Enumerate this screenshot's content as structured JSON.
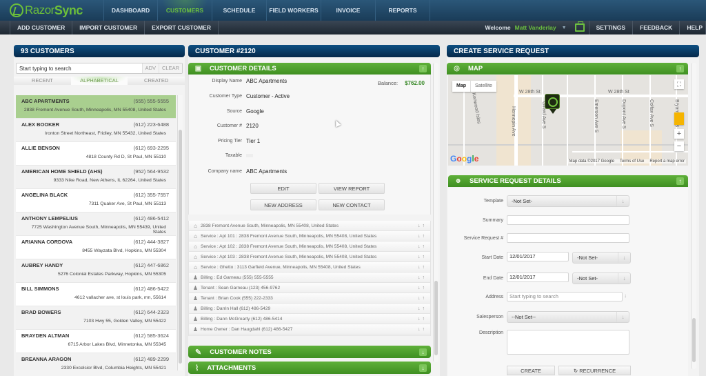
{
  "brand": {
    "name_part1": "Razor",
    "name_part2": "Sync",
    "accent": "#6cc040"
  },
  "nav": {
    "items": [
      {
        "label": "DASHBOARD",
        "active": false
      },
      {
        "label": "CUSTOMERS",
        "active": true
      },
      {
        "label": "SCHEDULE",
        "active": false
      },
      {
        "label": "FIELD WORKERS",
        "active": false
      },
      {
        "label": "INVOICE",
        "active": false
      },
      {
        "label": "REPORTS",
        "active": false
      }
    ]
  },
  "subnav": {
    "left": [
      "ADD CUSTOMER",
      "IMPORT CUSTOMER",
      "EXPORT CUSTOMER"
    ],
    "welcome": "Welcome",
    "user": "Matt Vanderlay",
    "caret": "▼",
    "right": [
      "SETTINGS",
      "FEEDBACK",
      "HELP"
    ]
  },
  "customers_panel": {
    "title": "93 CUSTOMERS",
    "search_placeholder": "Start typing to search",
    "adv_label": "ADV",
    "clear_label": "CLEAR",
    "tabs": [
      {
        "label": "RECENT",
        "active": false
      },
      {
        "label": "ALPHABETICAL",
        "active": true
      },
      {
        "label": "CREATED",
        "active": false
      }
    ],
    "customers": [
      {
        "name": "ABC APARTMENTS",
        "phone": "(555) 555-5555",
        "address": "2838 Fremont Avenue South, Minneapolis, MN 55408, United States",
        "selected": true
      },
      {
        "name": "ALEX BOOKER",
        "phone": "(612) 223-6488",
        "address": "Ironton Street Northeast, Fridley, MN 55432, United States"
      },
      {
        "name": "ALLIE BENSON",
        "phone": "(612) 693-2295",
        "address": "4818 County Rd D, St Paul, MN 55110"
      },
      {
        "name": "AMERICAN HOME SHIELD (AHS)",
        "phone": "(952) 564-9532",
        "address": "9333 Nike Road, New Athens, IL 62264, United States"
      },
      {
        "name": "ANGELINA BLACK",
        "phone": "(612) 355-7557",
        "address": "7311 Quaker Ave, St Paul, MN 55113"
      },
      {
        "name": "ANTHONY LEMPELIUS",
        "phone": "(612) 486-5412",
        "address": "7725 Washington Avenue South, Minneapolis, MN 55439, United States"
      },
      {
        "name": "ARIANNA CORDOVA",
        "phone": "(612) 444-3827",
        "address": "8455 Wayzata Blvd, Hopkins, MN 55304"
      },
      {
        "name": "AUBREY HANDY",
        "phone": "(612) 447-6862",
        "address": "5276 Colonial Estates Parkway, Hopkins, MN 55305"
      },
      {
        "name": "BILL SIMMONS",
        "phone": "(612) 486-5422",
        "address": "4612 vallacher ave, st louis park, mn, 55614"
      },
      {
        "name": "BRAD BOWERS",
        "phone": "(612) 644-2323",
        "address": "7103 Hwy 55, Golden Valley, MN 55422"
      },
      {
        "name": "BRAYDEN ALTMAN",
        "phone": "(612) 585-3624",
        "address": "6715 Arbor Lakes Blvd, Minnetonka, MN 55345"
      },
      {
        "name": "BREANNA ARAGON",
        "phone": "(612) 489-2299",
        "address": "2330 Excelsior Blvd, Columbia Heights, MN 55421"
      }
    ]
  },
  "customer_panel": {
    "title": "CUSTOMER #2120",
    "details_header": "CUSTOMER DETAILS",
    "balance_label": "Balance:",
    "balance_value": "$762.00",
    "fields": [
      {
        "label": "Display Name",
        "value": "ABC Apartments"
      },
      {
        "label": "Customer Type",
        "value": "Customer - Active"
      },
      {
        "label": "Source",
        "value": "Google"
      },
      {
        "label": "Customer #",
        "value": "2120"
      },
      {
        "label": "Pricing Tier",
        "value": "Tier 1"
      },
      {
        "label": "Taxable",
        "value": ""
      },
      {
        "label": "Company name",
        "value": "ABC Apartments"
      }
    ],
    "buttons": {
      "edit": "EDIT",
      "view_report": "VIEW REPORT",
      "new_address": "NEW ADDRESS",
      "new_contact": "NEW CONTACT"
    },
    "entries": [
      {
        "type": "address",
        "text": "2838 Fremont Avenue South, Minneapolis, MN 55408, United States"
      },
      {
        "type": "address",
        "text": "Service : Apt 101 : 2838 Fremont Avenue South, Minneapolis, MN 55408, United States"
      },
      {
        "type": "address",
        "text": "Service : Apt 102 : 2838 Fremont Avenue South, Minneapolis, MN 55408, United States"
      },
      {
        "type": "address",
        "text": "Service : Apt 103 : 2838 Fremont Avenue South, Minneapolis, MN 55408, United States"
      },
      {
        "type": "address",
        "text": "Service : Ghetto : 3113 Garfield Avenue, Minneapolis, MN 55408, United States"
      },
      {
        "type": "contact",
        "text": "Billing : Ed Garneau (555) 555-5555"
      },
      {
        "type": "contact",
        "text": "Tenant : Sean Garneau (123) 456-9762"
      },
      {
        "type": "contact",
        "text": "Tenant : Brian Cook (555) 222-2333"
      },
      {
        "type": "contact",
        "text": "Billing : Darrin Hall (612) 486-5429"
      },
      {
        "type": "contact",
        "text": "Billing : Dann McGroarty (612) 486-5414"
      },
      {
        "type": "contact",
        "text": "Home Owner : Dan Haugdahl (612) 486-5427"
      }
    ],
    "notes_header": "CUSTOMER NOTES",
    "attachments_header": "ATTACHMENTS"
  },
  "service_panel": {
    "title": "CREATE SERVICE REQUEST",
    "map_header": "MAP",
    "map": {
      "type_map": "Map",
      "type_satellite": "Satellite",
      "streets": [
        "W 28th St",
        "W 28th St",
        "Hennepin Ave",
        "Girard Ave S",
        "Emerson Ave S",
        "Dupont Ave S",
        "Colfax Ave S",
        "Bryant Ave S",
        "Kenwood Isles"
      ],
      "attribution": "Map data ©2017 Google",
      "terms": "Terms of Use",
      "report": "Report a map error",
      "google": "Google"
    },
    "details_header": "SERVICE REQUEST DETAILS",
    "form": {
      "template_label": "Template",
      "template_value": "-Not Set-",
      "summary_label": "Summary",
      "summary_value": "",
      "sr_label": "Service Request #",
      "sr_value": "",
      "start_label": "Start Date",
      "start_value": "12/01/2017",
      "start_time": "-Not Set-",
      "end_label": "End Date",
      "end_value": "12/01/2017",
      "end_time": "-Not Set-",
      "address_label": "Address",
      "address_placeholder": "Start typing to search",
      "salesperson_label": "Salesperson",
      "salesperson_value": "--Not Set--",
      "description_label": "Description",
      "description_value": ""
    },
    "buttons": {
      "create": "CREATE",
      "recurrence": "RECURRENCE"
    }
  }
}
